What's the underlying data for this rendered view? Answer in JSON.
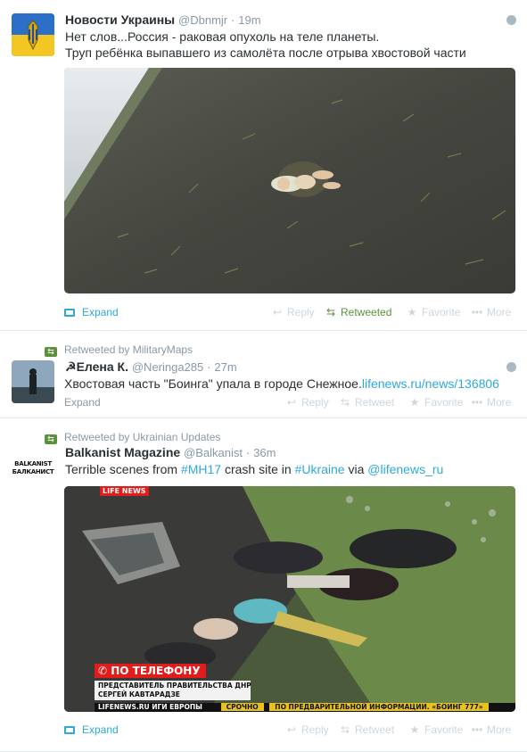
{
  "tweets": [
    {
      "name": "Новости Украины",
      "handle": "@Dbnmjr",
      "time": "19m",
      "text_line1": "Нет слов...Россия - раковая опухоль на теле планеты.",
      "text_line2": "Труп ребёнка выпавшего из самолёта после отрыва хвостовой части",
      "expand": "Expand",
      "actions": {
        "reply": "Reply",
        "retweet": "Retweeted",
        "favorite": "Favorite",
        "more": "More"
      }
    },
    {
      "retweeted_by": "Retweeted by MilitaryMaps",
      "name_prefix": "☭",
      "name": "Елена К.",
      "handle": "@Neringa285",
      "time": "27m",
      "text": "Хвостовая часть \"Боинга\" упала в городе Снежное.",
      "link": "lifenews.ru/news/136806",
      "expand": "Expand",
      "actions": {
        "reply": "Reply",
        "retweet": "Retweet",
        "favorite": "Favorite",
        "more": "More"
      }
    },
    {
      "retweeted_by": "Retweeted by Ukrainian Updates",
      "name": "Balkanist Magazine",
      "handle": "@Balkanist",
      "time": "36m",
      "text_pre": "Terrible scenes from ",
      "hashtag1": "#MH17",
      "text_mid": " crash site in ",
      "hashtag2": "#Ukraine",
      "text_via": " via ",
      "mention": "@lifenews_ru",
      "avatar_text_1": "BALKANIST",
      "avatar_text_2": "БАЛКАНИСТ",
      "media_overlay": {
        "logo": "LIFE NEWS",
        "banner": "ПО ТЕЛЕФОНУ",
        "caption1": "ПРЕДСТАВИТЕЛЬ ПРАВИТЕЛЬСТВА ДНР",
        "caption2": "СЕРГЕЙ КАВТАРАДЗЕ",
        "ticker_site": "LIFENEWS.RU",
        "ticker_text": "ИГИ ЕВРОПЫ",
        "ticker_urgent": "СРОЧНО",
        "ticker_info": "ПО ПРЕДВАРИТЕЛЬНОЙ ИНФОРМАЦИИ. «БОИНГ 777»"
      },
      "expand": "Expand",
      "actions": {
        "reply": "Reply",
        "retweet": "Retweet",
        "favorite": "Favorite",
        "more": "More"
      }
    }
  ],
  "colors": {
    "link": "#2fa8d9",
    "retweet_active": "#5c913b",
    "muted": "#8899a6"
  }
}
